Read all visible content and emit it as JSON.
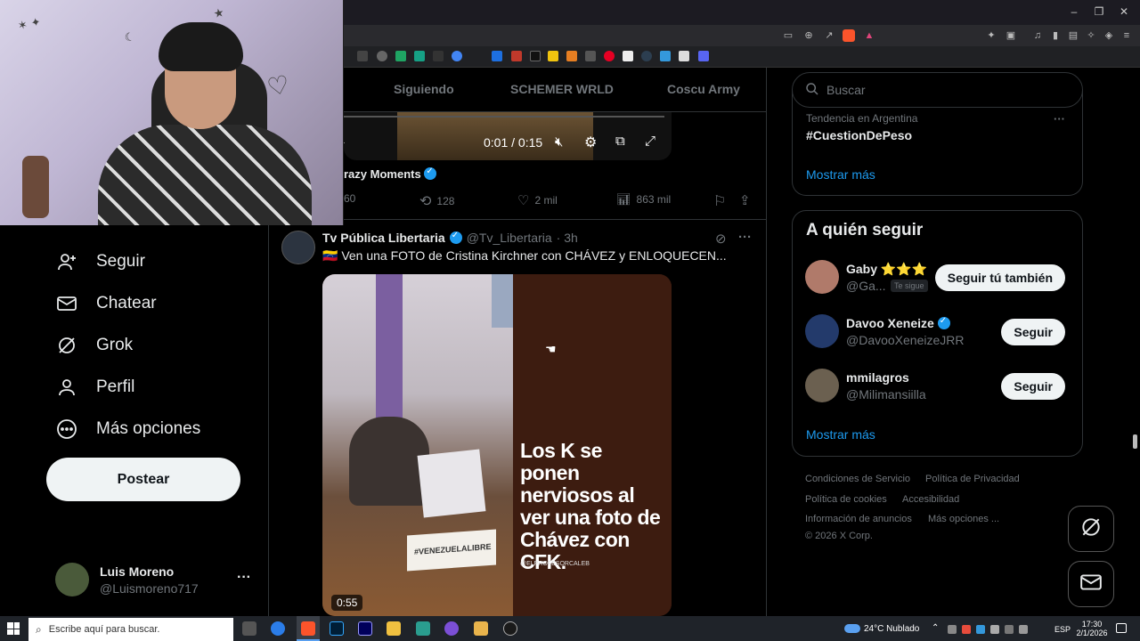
{
  "window": {
    "minimize": "–",
    "restore": "❐",
    "close": "✕"
  },
  "tabs": [
    "Siguiendo",
    "SCHEMER WRLD",
    "Coscu Army"
  ],
  "prev_tweet": {
    "video_time": "0:01 / 0:15",
    "author": "Crazy Moments",
    "author_prefix_cut": "razy Moments",
    "replies": "60",
    "reposts": "128",
    "likes": "2 mil",
    "views": "863 mil"
  },
  "tweet": {
    "author": "Tv Pública Libertaria",
    "handle": "@Tv_Libertaria",
    "time": "· 3h",
    "text": "Ven una FOTO de Cristina Kirchner con CHÁVEZ y ENLOQUECEN...",
    "flag": "🇻🇪",
    "video_duration": "0:55",
    "overlay_text": "Los K se ponen nerviosos al ver una foto de Chávez con CFK.",
    "overlay_credit": "@ELPROFESORCALEB",
    "sign_text": "#VENEZUELALIBRE"
  },
  "nav": {
    "items": [
      {
        "label": "Seguir",
        "icon": "person-add-icon"
      },
      {
        "label": "Chatear",
        "icon": "mail-icon"
      },
      {
        "label": "Grok",
        "icon": "grok-icon"
      },
      {
        "label": "Perfil",
        "icon": "person-icon"
      },
      {
        "label": "Más opciones",
        "icon": "more-circle-icon"
      }
    ],
    "post_label": "Postear"
  },
  "profile": {
    "name": "Luis Moreno",
    "handle": "@Luismoreno717",
    "more": "···"
  },
  "search": {
    "placeholder": "Buscar"
  },
  "trends": {
    "context": "Tendencia en Argentina",
    "tag": "#CuestionDePeso",
    "show_more": "Mostrar más"
  },
  "who_to_follow": {
    "title": "A quién seguir",
    "users": [
      {
        "name": "Gaby ⭐⭐⭐",
        "handle": "@Ga...",
        "badge": "Te sigue",
        "button": "Seguir tú también",
        "color": "#b07a6a"
      },
      {
        "name": "Davoo Xeneize",
        "handle": "@DavooXeneizeJRR",
        "badge": "",
        "button": "Seguir",
        "color": "#233a6b"
      },
      {
        "name": "mmilagros",
        "handle": "@Milimansiilla",
        "badge": "",
        "button": "Seguir",
        "color": "#6b6050"
      }
    ],
    "show_more": "Mostrar más"
  },
  "footer": {
    "links": [
      "Condiciones de Servicio",
      "Política de Privacidad",
      "Política de cookies",
      "Accesibilidad",
      "Información de anuncios",
      "Más opciones ..."
    ],
    "copyright": "© 2026 X Corp."
  },
  "taskbar": {
    "search_placeholder": "Escribe aquí para buscar.",
    "weather": "24°C  Nublado",
    "lang": "ESP",
    "time": "17:30",
    "date": "2/1/2026"
  },
  "colors": {
    "accent": "#1d9bf0",
    "bg": "#000000",
    "border": "#2f3336",
    "muted": "#71767b"
  }
}
